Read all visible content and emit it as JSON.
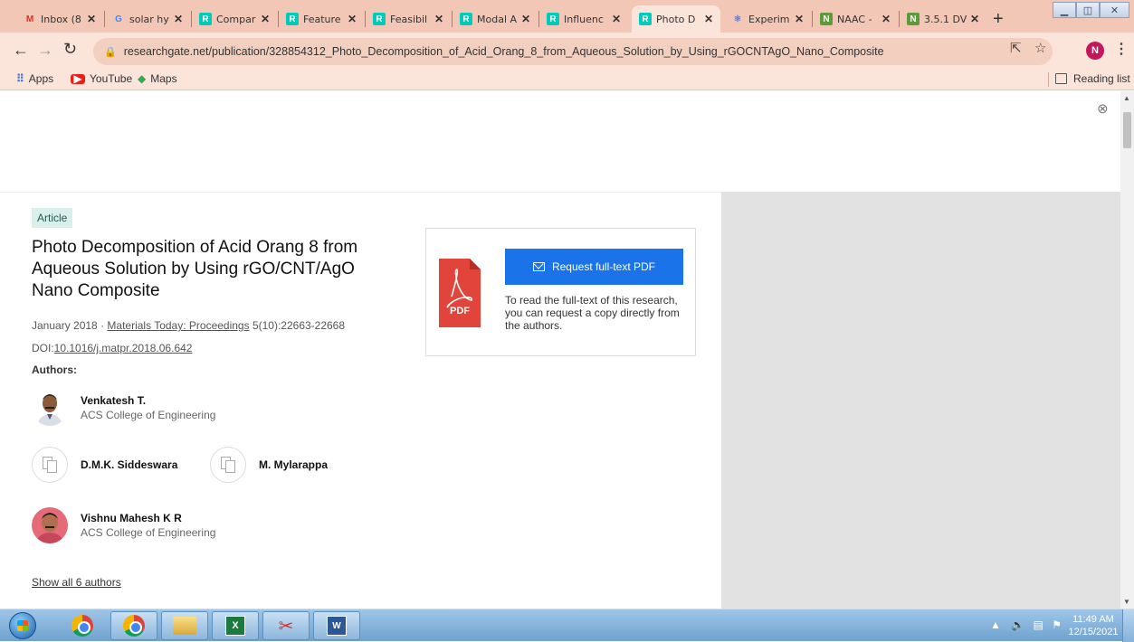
{
  "browser": {
    "tabs": [
      {
        "title": "Inbox (8",
        "icon": "gmail-icon"
      },
      {
        "title": "solar hy",
        "icon": "google-icon"
      },
      {
        "title": "Compar",
        "icon": "researchgate-icon"
      },
      {
        "title": "Feature",
        "icon": "researchgate-icon"
      },
      {
        "title": "Feasibil",
        "icon": "researchgate-icon"
      },
      {
        "title": "Modal A",
        "icon": "researchgate-icon"
      },
      {
        "title": "Influenc",
        "icon": "researchgate-icon"
      },
      {
        "title": "Photo D",
        "icon": "researchgate-icon",
        "active": true
      },
      {
        "title": "Experim",
        "icon": "react-icon"
      },
      {
        "title": "NAAC -",
        "icon": "naac-icon"
      },
      {
        "title": "3.5.1 DV",
        "icon": "naac-icon"
      }
    ],
    "close_glyph": "✕",
    "new_tab": "+",
    "url": "researchgate.net/publication/328854312_Photo_Decomposition_of_Acid_Orang_8_from_Aqueous_Solution_by_Using_rGOCNTAgO_Nano_Composite",
    "profile_initial": "N",
    "bookmarks": [
      {
        "label": "Apps",
        "icon": "apps-grid-icon"
      },
      {
        "label": "YouTube",
        "icon": "youtube-icon"
      },
      {
        "label": "Maps",
        "icon": "maps-icon"
      }
    ],
    "reading_list": "Reading list"
  },
  "article": {
    "type_badge": "Article",
    "title": "Photo Decomposition of Acid Orang 8 from Aqueous Solution by Using rGO/CNT/AgO Nano Composite",
    "date": "January 2018",
    "separator": " · ",
    "journal": "Materials Today: Proceedings",
    "volume": " 5(10):22663-22668",
    "doi_label": "DOI:",
    "doi": "10.1016/j.matpr.2018.06.642",
    "authors_label": "Authors:",
    "authors": [
      {
        "name": "Venkatesh T.",
        "institution": "ACS College of Engineering",
        "avatar": "photo"
      },
      {
        "name": "D.M.K. Siddeswara",
        "institution": "",
        "avatar": "placeholder"
      },
      {
        "name": "M. Mylarappa",
        "institution": "",
        "avatar": "placeholder"
      },
      {
        "name": "Vishnu Mahesh K R",
        "institution": "ACS College of Engineering",
        "avatar": "photo"
      }
    ],
    "show_all": "Show all 6 authors",
    "pdf_card": {
      "button": "Request full-text PDF",
      "description": "To read the full-text of this research, you can request a copy directly from the authors.",
      "pdf_label": "PDF"
    }
  },
  "taskbar": {
    "apps": [
      "chrome-icon",
      "chrome-profile-icon",
      "explorer-folder-icon",
      "excel-icon",
      "snipping-tool-icon",
      "word-icon"
    ],
    "time": "11:49 AM",
    "date": "12/15/2021"
  },
  "colors": {
    "tabstrip": "#f3c7b6",
    "toolbar": "#fbe4da",
    "accent_button": "#1a73e8",
    "badge_bg": "#d8efeb",
    "pdf_red": "#e0443a"
  }
}
